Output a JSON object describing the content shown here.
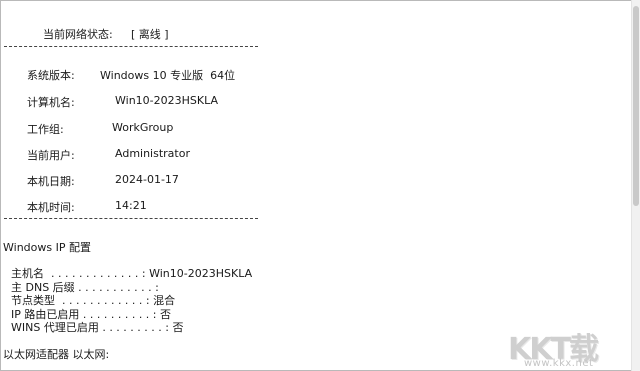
{
  "network_status": {
    "label": "当前网络状态:",
    "value": "[ 离线 ]"
  },
  "system_info": [
    {
      "label": "系统版本:",
      "value": "Windows 10 专业版  64位"
    },
    {
      "label": "计算机名:",
      "value": "Win10-2023HSKLA"
    },
    {
      "label": "工作组:",
      "value": "WorkGroup"
    },
    {
      "label": "当前用户:",
      "value": "Administrator"
    },
    {
      "label": "本机日期:",
      "value": "2024-01-17"
    },
    {
      "label": "本机时间:",
      "value": "14:21"
    }
  ],
  "ip_config": {
    "title": "Windows IP 配置",
    "lines": [
      "主机名  . . . . . . . . . . . . . : Win10-2023HSKLA",
      "主 DNS 后缀 . . . . . . . . . . . :",
      "节点类型  . . . . . . . . . . . . : 混合",
      "IP 路由已启用 . . . . . . . . . . : 否",
      "WINS 代理已启用 . . . . . . . . . : 否"
    ],
    "adapter": "以太网适配器 以太网:"
  },
  "watermark": {
    "logo": "KKT载",
    "url": "www.kkx.net"
  }
}
